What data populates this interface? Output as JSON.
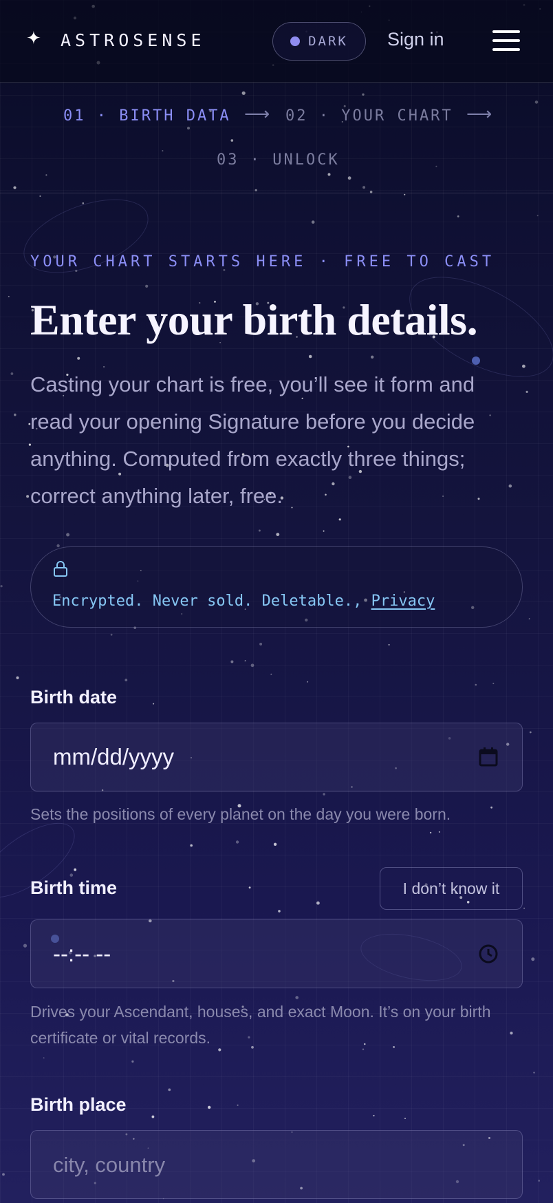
{
  "header": {
    "logo_text": "ASTROSENSE",
    "theme_label": "DARK",
    "sign_in": "Sign in"
  },
  "steps": {
    "step1": "01 · BIRTH DATA",
    "step2": "02 · YOUR CHART",
    "step3": "03 · UNLOCK",
    "arrow": "⟶"
  },
  "hero": {
    "eyebrow": "YOUR CHART STARTS HERE · FREE TO CAST",
    "title": "Enter your birth details.",
    "intro": "Casting your chart is free, you’ll see it form and read your opening Signature before you decide anything. Computed from exactly three things; correct anything later, free."
  },
  "privacy": {
    "text": "Encrypted. Never sold. Deletable., ",
    "link": "Privacy"
  },
  "form": {
    "birth_date": {
      "label": "Birth date",
      "value": "mm/dd/yyyy",
      "help": "Sets the positions of every planet on the day you were born."
    },
    "birth_time": {
      "label": "Birth time",
      "value": "--:-- --",
      "unknown_button": "I don’t know it",
      "help": "Drives your Ascendant, houses, and exact Moon. It’s on your birth certificate or vital records."
    },
    "birth_place": {
      "label": "Birth place",
      "placeholder": "city, country"
    }
  },
  "icons": [
    "sparkle-logo-icon",
    "hamburger-menu-icon",
    "lock-icon",
    "calendar-icon",
    "clock-icon"
  ],
  "colors": {
    "accent": "#8b8ef5",
    "link": "#86c6f3",
    "background_top": "#090b25",
    "background_bottom": "#22205e"
  }
}
